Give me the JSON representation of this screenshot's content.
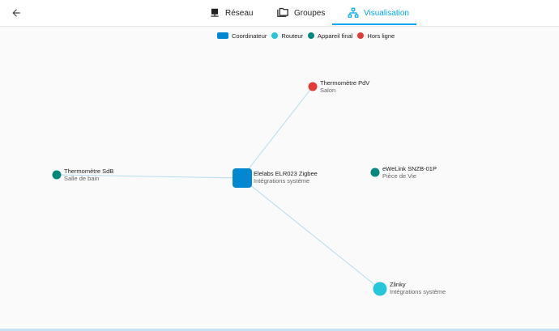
{
  "header": {
    "tabs": [
      {
        "label": "Réseau",
        "active": false
      },
      {
        "label": "Groupes",
        "active": false
      },
      {
        "label": "Visualisation",
        "active": true
      }
    ]
  },
  "legend": {
    "coordinator": "Coordinateur",
    "router": "Routeur",
    "end_device": "Appareil final",
    "offline": "Hors ligne"
  },
  "colors": {
    "coordinator": "#0288d1",
    "router": "#26c6da",
    "end_device": "#00897b",
    "offline": "#e53935",
    "accent": "#03a9f4",
    "link": "#b3dcef"
  },
  "nodes": {
    "coordinator": {
      "name": "Elelabs ELR023 Zigbee",
      "area": "Intégrations système",
      "type": "coordinator"
    },
    "thermo_pdv": {
      "name": "Thermomètre PdV",
      "area": "Salon",
      "type": "offline"
    },
    "thermo_sdb": {
      "name": "Thermomètre SdB",
      "area": "Salle de bain",
      "type": "end_device"
    },
    "ewelink": {
      "name": "eWeLink SNZB-01P",
      "area": "Pièce de Vie",
      "type": "end_device"
    },
    "zlinky": {
      "name": "Zlinky",
      "area": "Intégrations système",
      "type": "router"
    }
  }
}
